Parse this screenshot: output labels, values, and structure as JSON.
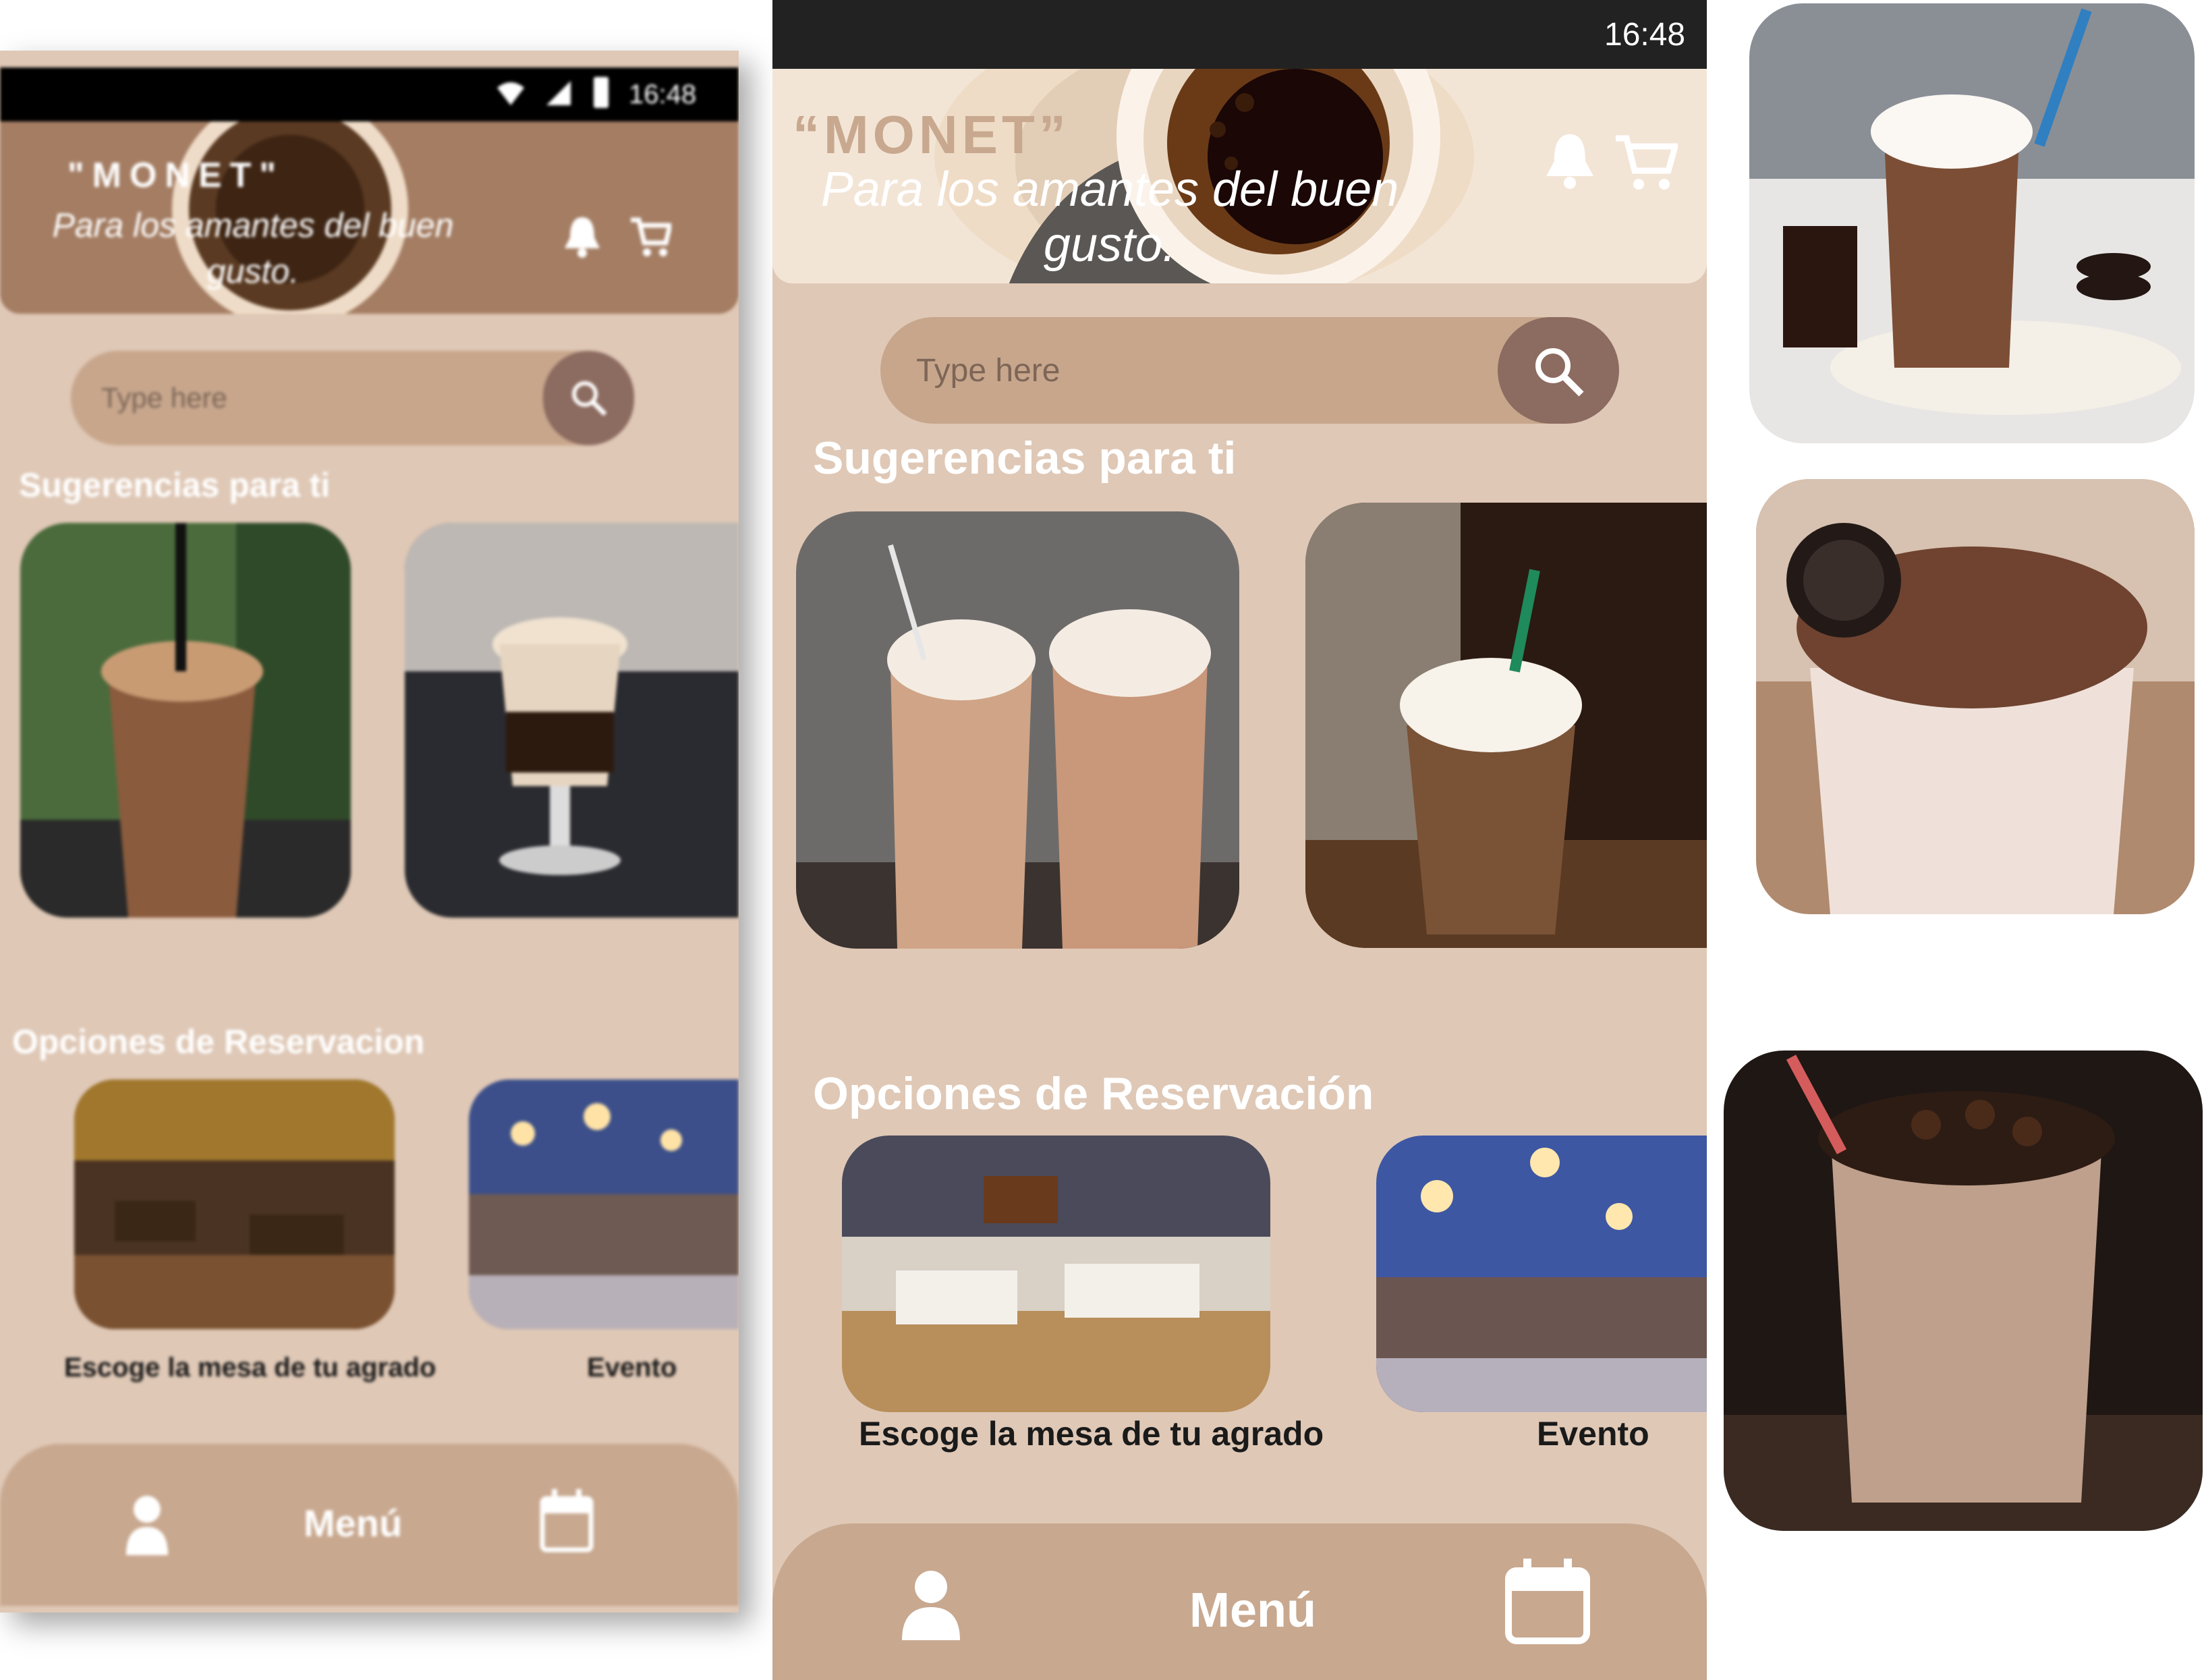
{
  "colors": {
    "background": "#dfc8b6",
    "header": "#a47d63",
    "search_pill": "#c7a68c",
    "search_button": "#8c6b60",
    "nav_bar": "#c8a88f",
    "status_bar": "#222222",
    "text_white": "#ffffff",
    "text_dark": "#1a1a1a"
  },
  "left_phone": {
    "status_time": "16:48",
    "brand": "\"MONET\"",
    "tagline": "Para los amantes del buen gusto.",
    "search_placeholder": "Type here",
    "suggestions_title": "Sugerencias para ti",
    "reservation_title": "Opciones de Reservacion",
    "reservation_items": [
      {
        "label": "Escoge la mesa de tu agrado"
      },
      {
        "label": "Evento"
      }
    ],
    "nav": {
      "menu_label": "Menú"
    }
  },
  "mid_phone": {
    "status_time": "16:48",
    "brand": "“MONET”",
    "tagline": "Para los amantes del buen gusto.",
    "search_placeholder": "Type here",
    "suggestions_title": "Sugerencias para ti",
    "reservation_title": "Opciones de Reservación",
    "reservation_items": [
      {
        "label": "Escoge la mesa de tu agrado"
      },
      {
        "label": "Evento"
      }
    ],
    "nav": {
      "menu_label": "Menú"
    }
  },
  "icons": [
    "wifi-icon",
    "signal-icon",
    "battery-icon",
    "bell-icon",
    "cart-icon",
    "search-icon",
    "user-icon",
    "calendar-icon"
  ]
}
